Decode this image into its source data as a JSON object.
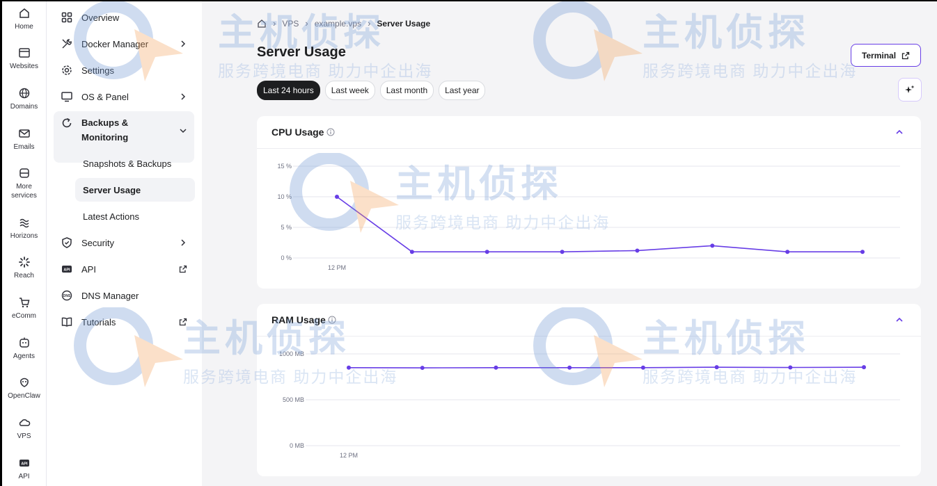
{
  "rail": [
    {
      "label": "Home",
      "icon": "home-icon"
    },
    {
      "label": "Websites",
      "icon": "browser-icon"
    },
    {
      "label": "Domains",
      "icon": "globe-icon"
    },
    {
      "label": "Emails",
      "icon": "mail-icon"
    },
    {
      "label": "More\nservices",
      "icon": "box-icon"
    },
    {
      "label": "Horizons",
      "icon": "horizons-icon"
    },
    {
      "label": "Reach",
      "icon": "reach-icon"
    },
    {
      "label": "eComm",
      "icon": "cart-icon"
    },
    {
      "label": "Agents",
      "icon": "agent-icon"
    },
    {
      "label": "OpenClaw",
      "icon": "claw-icon"
    },
    {
      "label": "VPS",
      "icon": "cloud-icon"
    },
    {
      "label": "API",
      "icon": "api-icon"
    }
  ],
  "nav": {
    "overview": "Overview",
    "docker": "Docker Manager",
    "settings": "Settings",
    "os_panel": "OS & Panel",
    "backups": "Backups &\nMonitoring",
    "snapshots": "Snapshots & Backups",
    "server_usage": "Server Usage",
    "latest_actions": "Latest Actions",
    "security": "Security",
    "api": "API",
    "dns": "DNS Manager",
    "tutorials": "Tutorials"
  },
  "breadcrumb": {
    "vps": "VPS",
    "host": "example.vps",
    "current": "Server Usage"
  },
  "page_title": "Server Usage",
  "filters": [
    "Last 24 hours",
    "Last week",
    "Last month",
    "Last year"
  ],
  "active_filter": "Last 24 hours",
  "terminal_label": "Terminal",
  "accent": "#673de6",
  "watermark": {
    "big": "主机侦探",
    "small": "服务跨境电商  助力中企出海"
  },
  "chart_data": [
    {
      "type": "line",
      "title": "CPU Usage",
      "x": [
        "12 PM",
        "",
        "",
        "",
        "",
        "",
        "",
        ""
      ],
      "x_ticks": [
        "12 PM"
      ],
      "y_ticks": [
        "15 %",
        "10 %",
        "5 %",
        "0 %"
      ],
      "ylim": [
        0,
        15
      ],
      "series": [
        {
          "values": [
            10,
            1,
            1,
            1,
            1.2,
            2,
            1,
            1
          ]
        }
      ],
      "color": "#673de6",
      "grid": true
    },
    {
      "type": "line",
      "title": "RAM Usage",
      "x": [
        "12 PM",
        "",
        "",
        "",
        "",
        "",
        "",
        ""
      ],
      "x_ticks": [
        "12 PM"
      ],
      "y_ticks": [
        "1000 MB",
        "500 MB",
        "0 MB"
      ],
      "ylim": [
        0,
        1000
      ],
      "series": [
        {
          "values": [
            850,
            848,
            850,
            850,
            850,
            855,
            852,
            855
          ]
        }
      ],
      "color": "#673de6",
      "grid": true
    }
  ]
}
